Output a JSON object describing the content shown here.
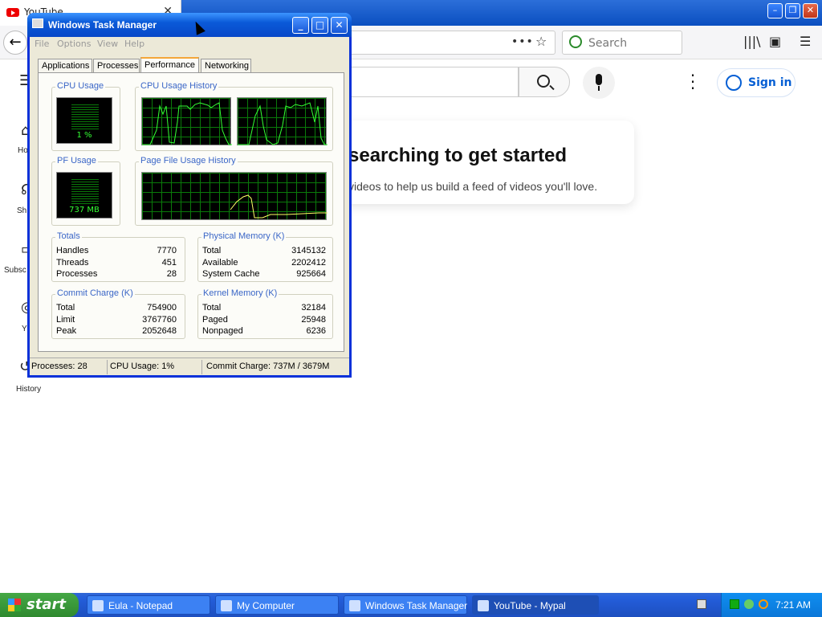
{
  "browser": {
    "tab_title": "YouTube",
    "search_placeholder": "Search",
    "signin_label": "Sign in",
    "promo_title": "searching to get started",
    "promo_subtitle": "videos to help us build a feed of videos you'll love.",
    "sidebar": [
      {
        "label": "Ho",
        "icon": "home-icon"
      },
      {
        "label": "Sh",
        "icon": "shorts-icon"
      },
      {
        "label": "Subsc",
        "icon": "subscriptions-icon"
      },
      {
        "label": "Y",
        "icon": "you-icon"
      },
      {
        "label": "History",
        "icon": "history-icon"
      }
    ]
  },
  "task_manager": {
    "title": "Windows Task Manager",
    "menu": [
      "File",
      "Options",
      "View",
      "Help"
    ],
    "tabs": [
      "Applications",
      "Processes",
      "Performance",
      "Networking"
    ],
    "active_tab": "Performance",
    "cpu_usage_title": "CPU Usage",
    "cpu_usage_value": "1 %",
    "cpu_history_title": "CPU Usage History",
    "pf_usage_title": "PF Usage",
    "pf_usage_value": "737 MB",
    "pf_history_title": "Page File Usage History",
    "totals": {
      "title": "Totals",
      "rows": [
        {
          "label": "Handles",
          "value": "7770"
        },
        {
          "label": "Threads",
          "value": "451"
        },
        {
          "label": "Processes",
          "value": "28"
        }
      ]
    },
    "physical_memory": {
      "title": "Physical Memory (K)",
      "rows": [
        {
          "label": "Total",
          "value": "3145132"
        },
        {
          "label": "Available",
          "value": "2202412"
        },
        {
          "label": "System Cache",
          "value": "925664"
        }
      ]
    },
    "commit_charge": {
      "title": "Commit Charge (K)",
      "rows": [
        {
          "label": "Total",
          "value": "754900"
        },
        {
          "label": "Limit",
          "value": "3767760"
        },
        {
          "label": "Peak",
          "value": "2052648"
        }
      ]
    },
    "kernel_memory": {
      "title": "Kernel Memory (K)",
      "rows": [
        {
          "label": "Total",
          "value": "32184"
        },
        {
          "label": "Paged",
          "value": "25948"
        },
        {
          "label": "Nonpaged",
          "value": "6236"
        }
      ]
    },
    "status": {
      "processes": "Processes: 28",
      "cpu": "CPU Usage: 1%",
      "commit": "Commit Charge: 737M / 3679M"
    }
  },
  "taskbar": {
    "start_label": "start",
    "tasks": [
      {
        "label": "Eula - Notepad",
        "icon": "notepad-icon"
      },
      {
        "label": "My Computer",
        "icon": "computer-icon"
      },
      {
        "label": "Windows Task Manager",
        "icon": "taskmanager-icon"
      },
      {
        "label": "YouTube - Mypal",
        "icon": "browser-icon"
      }
    ],
    "clock": "7:21 AM"
  },
  "colors": {
    "xp_blue": "#0a5ad8",
    "graph_green": "#33ff33",
    "yt_red": "#ee0000",
    "signin_blue": "#065fd4",
    "group_title_blue": "#3a66c7"
  }
}
